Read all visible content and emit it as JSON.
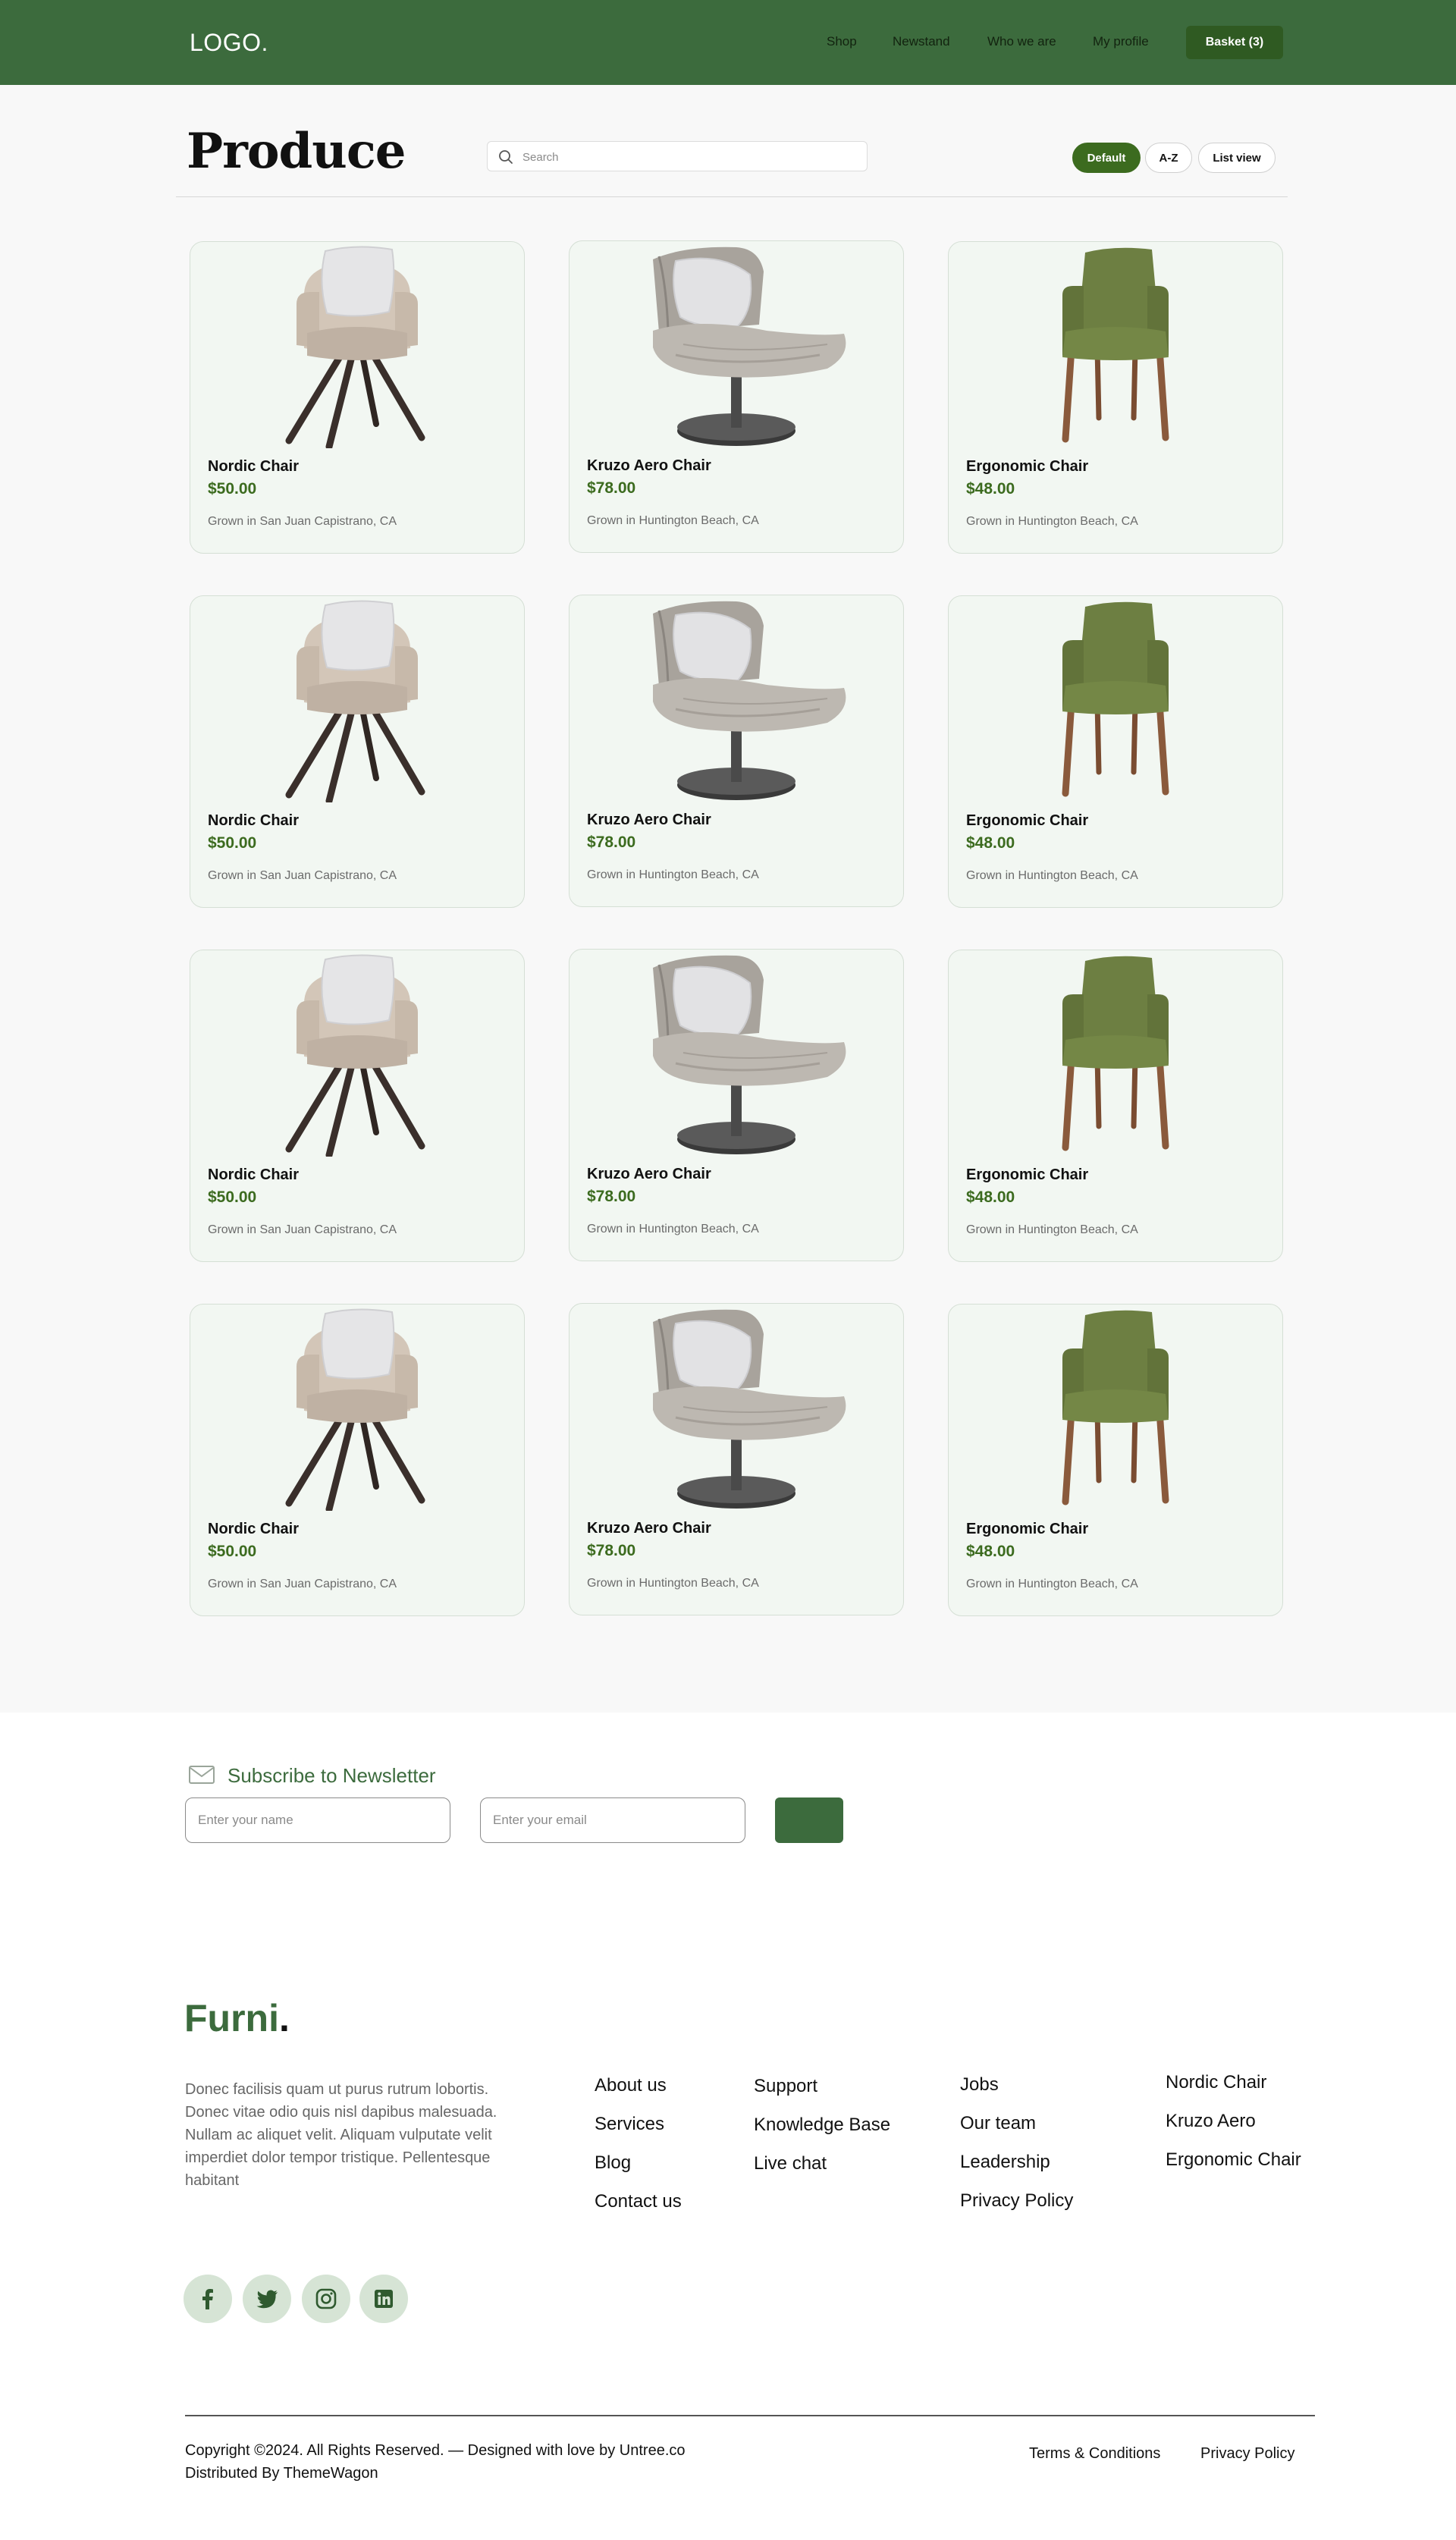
{
  "header": {
    "logo": "LOGO.",
    "nav": [
      "Shop",
      "Newstand",
      "Who we are",
      "My profile"
    ],
    "basket_label": "Basket (3)"
  },
  "main": {
    "title": "Produce",
    "search": {
      "placeholder": "Search",
      "value": ""
    },
    "filters": [
      "Default",
      "A-Z",
      "List view"
    ],
    "active_filter": "Default"
  },
  "products": [
    {
      "name": "Nordic Chair",
      "price": "$50.00",
      "origin": "Grown in San Juan Capistrano, CA",
      "image": "nordic-chair-image"
    },
    {
      "name": "Kruzo Aero Chair",
      "price": "$78.00",
      "origin": "Grown in Huntington Beach, CA",
      "image": "kruzo-aero-chair-image"
    },
    {
      "name": "Ergonomic Chair",
      "price": "$48.00",
      "origin": "Grown in Huntington Beach, CA",
      "image": "ergonomic-chair-image"
    },
    {
      "name": "Nordic Chair",
      "price": "$50.00",
      "origin": "Grown in San Juan Capistrano, CA",
      "image": "nordic-chair-image"
    },
    {
      "name": "Kruzo Aero Chair",
      "price": "$78.00",
      "origin": "Grown in Huntington Beach, CA",
      "image": "kruzo-aero-chair-image"
    },
    {
      "name": "Ergonomic Chair",
      "price": "$48.00",
      "origin": "Grown in Huntington Beach, CA",
      "image": "ergonomic-chair-image"
    },
    {
      "name": "Nordic Chair",
      "price": "$50.00",
      "origin": "Grown in San Juan Capistrano, CA",
      "image": "nordic-chair-image"
    },
    {
      "name": "Kruzo Aero Chair",
      "price": "$78.00",
      "origin": "Grown in Huntington Beach, CA",
      "image": "kruzo-aero-chair-image"
    },
    {
      "name": "Ergonomic Chair",
      "price": "$48.00",
      "origin": "Grown in Huntington Beach, CA",
      "image": "ergonomic-chair-image"
    },
    {
      "name": "Nordic Chair",
      "price": "$50.00",
      "origin": "Grown in San Juan Capistrano, CA",
      "image": "nordic-chair-image"
    },
    {
      "name": "Kruzo Aero Chair",
      "price": "$78.00",
      "origin": "Grown in Huntington Beach, CA",
      "image": "kruzo-aero-chair-image"
    },
    {
      "name": "Ergonomic Chair",
      "price": "$48.00",
      "origin": "Grown in Huntington Beach, CA",
      "image": "ergonomic-chair-image"
    }
  ],
  "newsletter": {
    "title": "Subscribe to Newsletter",
    "icon": "envelope-icon",
    "name_placeholder": "Enter your name",
    "email_placeholder": "Enter your email"
  },
  "footer": {
    "brand": "Furni",
    "brand_dot": ".",
    "about": "Donec facilisis quam ut purus rutrum lobortis. Donec vitae odio quis nisl dapibus malesuada. Nullam ac aliquet velit. Aliquam vulputate velit imperdiet dolor tempor tristique. Pellentesque habitant",
    "col1": [
      "About us",
      "Services",
      "Blog",
      "Contact us"
    ],
    "col2": [
      "Support",
      "Knowledge Base",
      "Live chat"
    ],
    "col3": [
      "Jobs",
      "Our team",
      "Leadership",
      "Privacy Policy"
    ],
    "col4": [
      "Nordic Chair",
      "Kruzo Aero",
      "Ergonomic Chair"
    ],
    "social": [
      "facebook-icon",
      "twitter-icon",
      "instagram-icon",
      "linkedin-icon"
    ],
    "copyright": "Copyright ©2024. All Rights Reserved. — Designed with love by Untree.co",
    "distributed": "Distributed By ThemeWagon",
    "legal": [
      "Terms & Conditions",
      "Privacy Policy"
    ]
  },
  "colors": {
    "brand_green": "#3c6b3d",
    "price_green": "#3c6b1f",
    "card_bg": "#f2f7f2",
    "social_bg": "#d6e4d5"
  }
}
